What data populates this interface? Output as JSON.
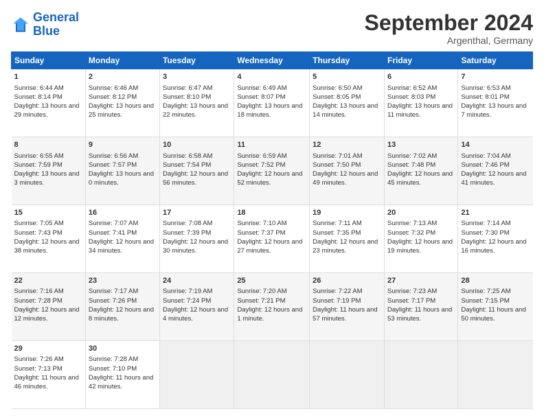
{
  "header": {
    "logo_line1": "General",
    "logo_line2": "Blue",
    "title": "September 2024",
    "subtitle": "Argenthal, Germany"
  },
  "columns": [
    "Sunday",
    "Monday",
    "Tuesday",
    "Wednesday",
    "Thursday",
    "Friday",
    "Saturday"
  ],
  "rows": [
    [
      {
        "day": "1",
        "sunrise": "Sunrise: 6:44 AM",
        "sunset": "Sunset: 8:14 PM",
        "daylight": "Daylight: 13 hours and 29 minutes."
      },
      {
        "day": "2",
        "sunrise": "Sunrise: 6:46 AM",
        "sunset": "Sunset: 8:12 PM",
        "daylight": "Daylight: 13 hours and 25 minutes."
      },
      {
        "day": "3",
        "sunrise": "Sunrise: 6:47 AM",
        "sunset": "Sunset: 8:10 PM",
        "daylight": "Daylight: 13 hours and 22 minutes."
      },
      {
        "day": "4",
        "sunrise": "Sunrise: 6:49 AM",
        "sunset": "Sunset: 8:07 PM",
        "daylight": "Daylight: 13 hours and 18 minutes."
      },
      {
        "day": "5",
        "sunrise": "Sunrise: 6:50 AM",
        "sunset": "Sunset: 8:05 PM",
        "daylight": "Daylight: 13 hours and 14 minutes."
      },
      {
        "day": "6",
        "sunrise": "Sunrise: 6:52 AM",
        "sunset": "Sunset: 8:03 PM",
        "daylight": "Daylight: 13 hours and 11 minutes."
      },
      {
        "day": "7",
        "sunrise": "Sunrise: 6:53 AM",
        "sunset": "Sunset: 8:01 PM",
        "daylight": "Daylight: 13 hours and 7 minutes."
      }
    ],
    [
      {
        "day": "8",
        "sunrise": "Sunrise: 6:55 AM",
        "sunset": "Sunset: 7:59 PM",
        "daylight": "Daylight: 13 hours and 3 minutes."
      },
      {
        "day": "9",
        "sunrise": "Sunrise: 6:56 AM",
        "sunset": "Sunset: 7:57 PM",
        "daylight": "Daylight: 13 hours and 0 minutes."
      },
      {
        "day": "10",
        "sunrise": "Sunrise: 6:58 AM",
        "sunset": "Sunset: 7:54 PM",
        "daylight": "Daylight: 12 hours and 56 minutes."
      },
      {
        "day": "11",
        "sunrise": "Sunrise: 6:59 AM",
        "sunset": "Sunset: 7:52 PM",
        "daylight": "Daylight: 12 hours and 52 minutes."
      },
      {
        "day": "12",
        "sunrise": "Sunrise: 7:01 AM",
        "sunset": "Sunset: 7:50 PM",
        "daylight": "Daylight: 12 hours and 49 minutes."
      },
      {
        "day": "13",
        "sunrise": "Sunrise: 7:02 AM",
        "sunset": "Sunset: 7:48 PM",
        "daylight": "Daylight: 12 hours and 45 minutes."
      },
      {
        "day": "14",
        "sunrise": "Sunrise: 7:04 AM",
        "sunset": "Sunset: 7:46 PM",
        "daylight": "Daylight: 12 hours and 41 minutes."
      }
    ],
    [
      {
        "day": "15",
        "sunrise": "Sunrise: 7:05 AM",
        "sunset": "Sunset: 7:43 PM",
        "daylight": "Daylight: 12 hours and 38 minutes."
      },
      {
        "day": "16",
        "sunrise": "Sunrise: 7:07 AM",
        "sunset": "Sunset: 7:41 PM",
        "daylight": "Daylight: 12 hours and 34 minutes."
      },
      {
        "day": "17",
        "sunrise": "Sunrise: 7:08 AM",
        "sunset": "Sunset: 7:39 PM",
        "daylight": "Daylight: 12 hours and 30 minutes."
      },
      {
        "day": "18",
        "sunrise": "Sunrise: 7:10 AM",
        "sunset": "Sunset: 7:37 PM",
        "daylight": "Daylight: 12 hours and 27 minutes."
      },
      {
        "day": "19",
        "sunrise": "Sunrise: 7:11 AM",
        "sunset": "Sunset: 7:35 PM",
        "daylight": "Daylight: 12 hours and 23 minutes."
      },
      {
        "day": "20",
        "sunrise": "Sunrise: 7:13 AM",
        "sunset": "Sunset: 7:32 PM",
        "daylight": "Daylight: 12 hours and 19 minutes."
      },
      {
        "day": "21",
        "sunrise": "Sunrise: 7:14 AM",
        "sunset": "Sunset: 7:30 PM",
        "daylight": "Daylight: 12 hours and 16 minutes."
      }
    ],
    [
      {
        "day": "22",
        "sunrise": "Sunrise: 7:16 AM",
        "sunset": "Sunset: 7:28 PM",
        "daylight": "Daylight: 12 hours and 12 minutes."
      },
      {
        "day": "23",
        "sunrise": "Sunrise: 7:17 AM",
        "sunset": "Sunset: 7:26 PM",
        "daylight": "Daylight: 12 hours and 8 minutes."
      },
      {
        "day": "24",
        "sunrise": "Sunrise: 7:19 AM",
        "sunset": "Sunset: 7:24 PM",
        "daylight": "Daylight: 12 hours and 4 minutes."
      },
      {
        "day": "25",
        "sunrise": "Sunrise: 7:20 AM",
        "sunset": "Sunset: 7:21 PM",
        "daylight": "Daylight: 12 hours and 1 minute."
      },
      {
        "day": "26",
        "sunrise": "Sunrise: 7:22 AM",
        "sunset": "Sunset: 7:19 PM",
        "daylight": "Daylight: 11 hours and 57 minutes."
      },
      {
        "day": "27",
        "sunrise": "Sunrise: 7:23 AM",
        "sunset": "Sunset: 7:17 PM",
        "daylight": "Daylight: 11 hours and 53 minutes."
      },
      {
        "day": "28",
        "sunrise": "Sunrise: 7:25 AM",
        "sunset": "Sunset: 7:15 PM",
        "daylight": "Daylight: 11 hours and 50 minutes."
      }
    ],
    [
      {
        "day": "29",
        "sunrise": "Sunrise: 7:26 AM",
        "sunset": "Sunset: 7:13 PM",
        "daylight": "Daylight: 11 hours and 46 minutes."
      },
      {
        "day": "30",
        "sunrise": "Sunrise: 7:28 AM",
        "sunset": "Sunset: 7:10 PM",
        "daylight": "Daylight: 11 hours and 42 minutes."
      },
      null,
      null,
      null,
      null,
      null
    ]
  ]
}
